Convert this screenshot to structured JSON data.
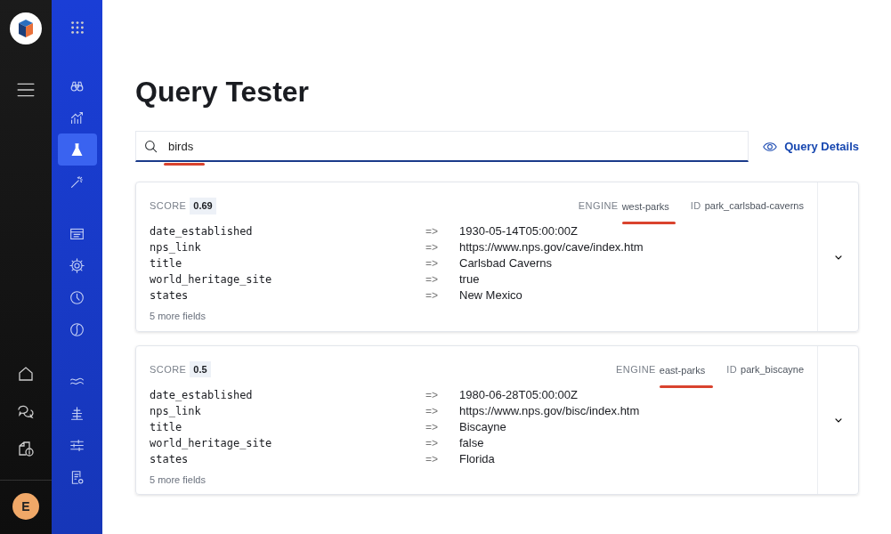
{
  "rail": {
    "avatar": "E"
  },
  "sidebar": {
    "groups": [
      {
        "items": [
          {
            "selected": false
          },
          {
            "selected": false
          },
          {
            "selected": true
          },
          {
            "selected": false
          }
        ]
      },
      {
        "items": [
          {
            "selected": false
          },
          {
            "selected": false
          },
          {
            "selected": false
          },
          {
            "selected": false
          }
        ]
      },
      {
        "items": [
          {
            "selected": false
          },
          {
            "selected": false
          },
          {
            "selected": false
          },
          {
            "selected": false
          }
        ]
      }
    ]
  },
  "page": {
    "title": "Query Tester"
  },
  "search": {
    "value": "birds",
    "marked": true
  },
  "query_details": "Query Details",
  "results": [
    {
      "score_label": "SCORE",
      "score": "0.69",
      "engine_label": "ENGINE",
      "engine": "west-parks",
      "engine_marked": true,
      "id_label": "ID",
      "id": "park_carlsbad-caverns",
      "fields": [
        {
          "key": "date_established",
          "arrow": "=>",
          "value": "1930-05-14T05:00:00Z"
        },
        {
          "key": "nps_link",
          "arrow": "=>",
          "value": "https://www.nps.gov/cave/index.htm"
        },
        {
          "key": "title",
          "arrow": "=>",
          "value": "Carlsbad Caverns"
        },
        {
          "key": "world_heritage_site",
          "arrow": "=>",
          "value": "true"
        },
        {
          "key": "states",
          "arrow": "=>",
          "value": "New Mexico"
        }
      ],
      "more": "5 more fields"
    },
    {
      "score_label": "SCORE",
      "score": "0.5",
      "engine_label": "ENGINE",
      "engine": "east-parks",
      "engine_marked": true,
      "id_label": "ID",
      "id": "park_biscayne",
      "fields": [
        {
          "key": "date_established",
          "arrow": "=>",
          "value": "1980-06-28T05:00:00Z"
        },
        {
          "key": "nps_link",
          "arrow": "=>",
          "value": "https://www.nps.gov/bisc/index.htm"
        },
        {
          "key": "title",
          "arrow": "=>",
          "value": "Biscayne"
        },
        {
          "key": "world_heritage_site",
          "arrow": "=>",
          "value": "false"
        },
        {
          "key": "states",
          "arrow": "=>",
          "value": "Florida"
        }
      ],
      "more": "5 more fields"
    }
  ]
}
